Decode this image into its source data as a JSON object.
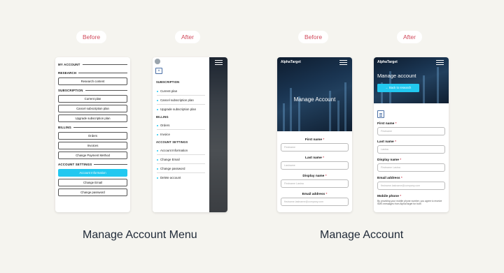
{
  "labels": {
    "before": "Before",
    "after": "After"
  },
  "captions": {
    "menu": "Manage Account Menu",
    "account": "Manage Account"
  },
  "screen1": {
    "sections": [
      {
        "title": "MY ACCOUNT"
      },
      {
        "title": "RESEARCH",
        "buttons": [
          "Research content"
        ]
      },
      {
        "title": "SUBSCRIPTION",
        "buttons": [
          "Current plan",
          "Cancel subscription plan",
          "Upgrade subscription plan"
        ]
      },
      {
        "title": "BILLING",
        "buttons": [
          "Orders",
          "Invoices",
          "Change Payment Method"
        ]
      },
      {
        "title": "ACCOUNT SETTINGS",
        "buttons": [
          "Account Information",
          "Change Email",
          "Change password"
        ]
      }
    ]
  },
  "screen2": {
    "subscription": "SUBSCRIPTION",
    "sub_items": [
      "Current plan",
      "Cancel subscription plan",
      "Upgrade subscription plan"
    ],
    "billing": "BILLING",
    "billing_items": [
      "Orders",
      "Invoice"
    ],
    "settings": "ACCOUNT SETTINGS",
    "settings_items": [
      "Account Information",
      "Change Email",
      "Change password",
      "Delete account"
    ]
  },
  "screen3": {
    "logo": "AlphaTarget",
    "hero_title": "Manage Account",
    "fields": [
      {
        "label": "First name",
        "placeholder": "Firstname"
      },
      {
        "label": "Last name",
        "placeholder": "Lastname"
      },
      {
        "label": "Display name",
        "placeholder": "Firstname Lastna"
      },
      {
        "label": "Email address",
        "placeholder": "firstname.lastname@company.com"
      }
    ]
  },
  "screen4": {
    "logo": "AlphaTarget",
    "hero_title": "Manage account",
    "back_button": "Back to research",
    "fields": [
      {
        "label": "First name",
        "placeholder": "Firstname"
      },
      {
        "label": "Last name",
        "placeholder": "Lastna"
      },
      {
        "label": "Display name",
        "placeholder": "Firstname Lastna"
      },
      {
        "label": "Email address",
        "placeholder": "firstname.lastname@company.com"
      }
    ],
    "mobile_label": "Mobile phone",
    "mobile_note": "By providing your mobile phone number, you agree to receive SMS messages from AlphaTarget for both"
  },
  "colors": {
    "background": "#f5f4ef",
    "accent": "#22c8f0",
    "label": "#d1495b"
  }
}
